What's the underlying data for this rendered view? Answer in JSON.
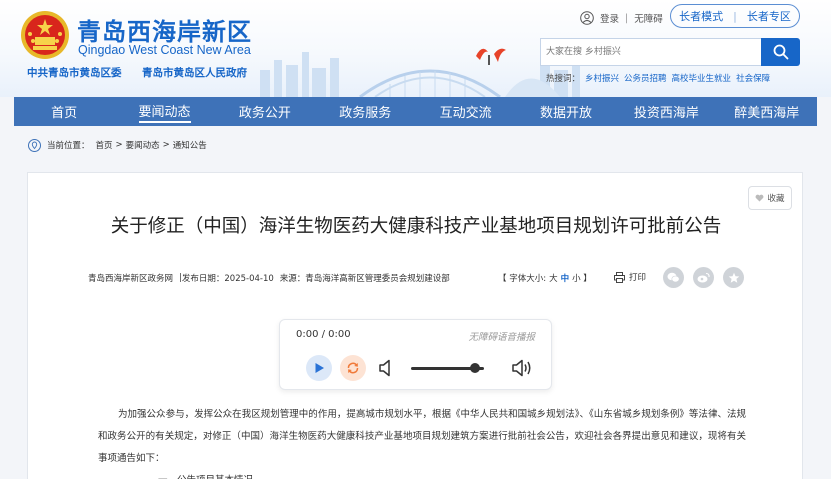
{
  "header": {
    "site_title": "青岛西海岸新区",
    "site_subtitle": "Qingdao West Coast New Area",
    "dept_1": "中共青岛市黄岛区委",
    "dept_2": "青岛市黄岛区人民政府",
    "login": "登录",
    "accessible": "无障碍",
    "elder_mode": "长者模式",
    "elder_version": "长者专区",
    "search_placeholder": "大家在搜 乡村振兴",
    "hot_label": "热搜词：",
    "hot_words": [
      "乡村振兴",
      "公务员招聘",
      "高校毕业生就业",
      "社会保障"
    ]
  },
  "nav": {
    "items": [
      "首页",
      "要闻动态",
      "政务公开",
      "政务服务",
      "互动交流",
      "数据开放",
      "投资西海岸",
      "醉美西海岸"
    ],
    "active_index": 1
  },
  "breadcrumb": {
    "label": "当前位置：",
    "crumbs": [
      "首页",
      "要闻动态",
      "通知公告"
    ],
    "sep": ">"
  },
  "article": {
    "favorite": "收藏",
    "title": "关于修正（中国）海洋生物医药大健康科技产业基地项目规划许可批前公告",
    "source": "青岛西海岸新区政务网",
    "publish_date": "发布日期：2025-04-10",
    "origin": "来源：青岛海洋高新区管理委员会规划建设部",
    "font_label": "【 字体大小: ",
    "font_large": "大",
    "font_medium": "中",
    "font_small": "小 】",
    "print": "打印",
    "paragraph_1": "为加强公众参与，发挥公众在我区规划管理中的作用，提高城市规划水平，根据《中华人民共和国城乡规划法》、《山东省城乡规划条例》等法律、法规和政务公开的有关规定，对修正（中国）海洋生物医药大健康科技产业基地项目规划建筑方案进行批前社会公告，欢迎社会各界提出意见和建议，现将有关事项通告如下：",
    "paragraph_2": "一、公告项目基本情况"
  },
  "player": {
    "time": "0:00 / 0:00",
    "tts_label": "无障碍语音播报",
    "volume": 0.87
  },
  "colors": {
    "brand": "#1766c8",
    "nav_bg": "#3e72b8"
  }
}
